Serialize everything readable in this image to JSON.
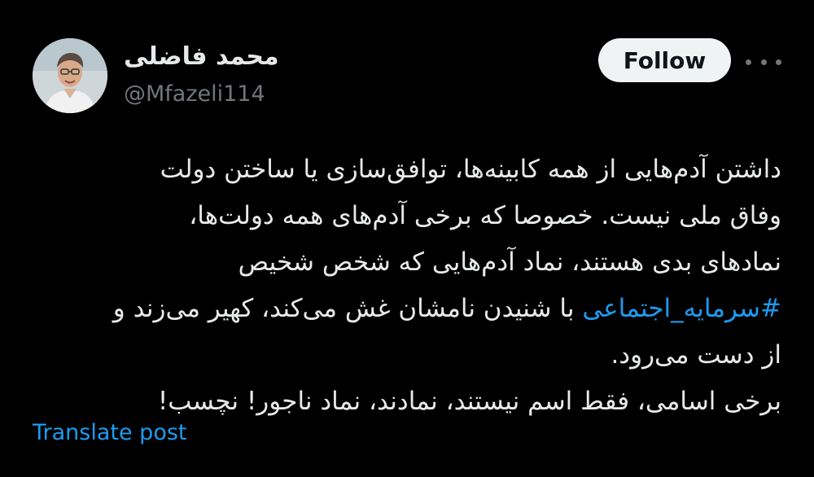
{
  "author": {
    "display_name": "محمد فاضلی",
    "handle": "@Mfazeli114"
  },
  "actions": {
    "follow_label": "Follow",
    "more_icon": "more-horizontal-icon"
  },
  "post": {
    "lines": [
      "داشتن آدم‌هایی از همه کابینه‌ها، توافق‌سازی یا ساختن دولت",
      "وفاق ملی نیست. خصوصا که برخی آدم‌های همه دولت‌ها،",
      "نمادهای بدی هستند، نماد آدم‌هایی که شخص شخیص"
    ],
    "hashtag": "#سرمایه_اجتماعی",
    "after_hashtag": " با شنیدن نامشان غش می‌کند، کهیر می‌زند و",
    "line5": "از دست می‌رود.",
    "line6": "برخی اسامی، فقط اسم نیستند، نمادند، نماد ناجور! نچسب!"
  },
  "footer": {
    "translate_label": "Translate post"
  },
  "colors": {
    "background": "#000000",
    "text": "#e7e9ea",
    "secondary": "#71767b",
    "link": "#1d9bf0",
    "button_bg": "#eff3f4"
  }
}
